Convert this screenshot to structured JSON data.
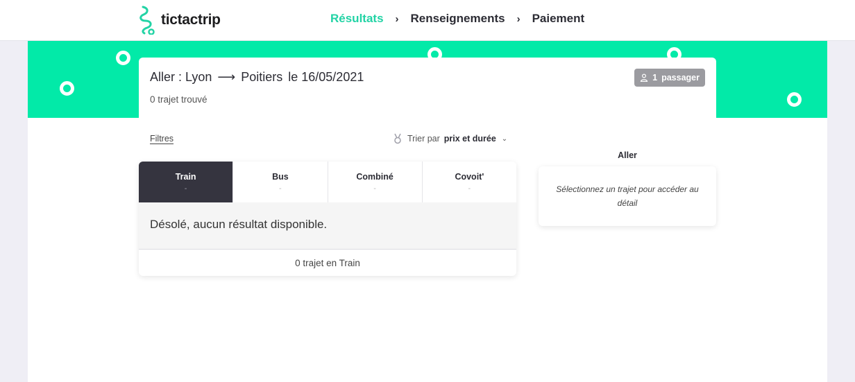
{
  "brand": {
    "name": "tictactrip"
  },
  "steps": [
    {
      "label": "Résultats"
    },
    {
      "label": "Renseignements"
    },
    {
      "label": "Paiement"
    }
  ],
  "step_separator": "›",
  "search": {
    "direction": "Aller :",
    "origin": "Lyon",
    "arrow": "⟶",
    "destination": "Poitiers",
    "date": "le 16/05/2021",
    "found_text": "0 trajet trouvé",
    "passenger_count": "1",
    "passenger_label": "passager"
  },
  "toolbar": {
    "filters_label": "Filtres",
    "sort_prefix": "Trier par",
    "sort_value": "prix et durée",
    "sort_chevron": "⌄"
  },
  "tabs": [
    {
      "name": "Train",
      "price": "-"
    },
    {
      "name": "Bus",
      "price": "-"
    },
    {
      "name": "Combiné",
      "price": "-"
    },
    {
      "name": "Covoit'",
      "price": "-"
    }
  ],
  "results": {
    "empty_message": "Désolé, aucun résultat disponible.",
    "count_text": "0 trajet en Train"
  },
  "detail_panel": {
    "title": "Aller",
    "placeholder": "Sélectionnez un trajet pour accéder au détail"
  },
  "colors": {
    "accent": "#22d3a5",
    "banner": "#02eaa8",
    "active_tab": "#35343f",
    "badge": "#9b9ba0"
  }
}
